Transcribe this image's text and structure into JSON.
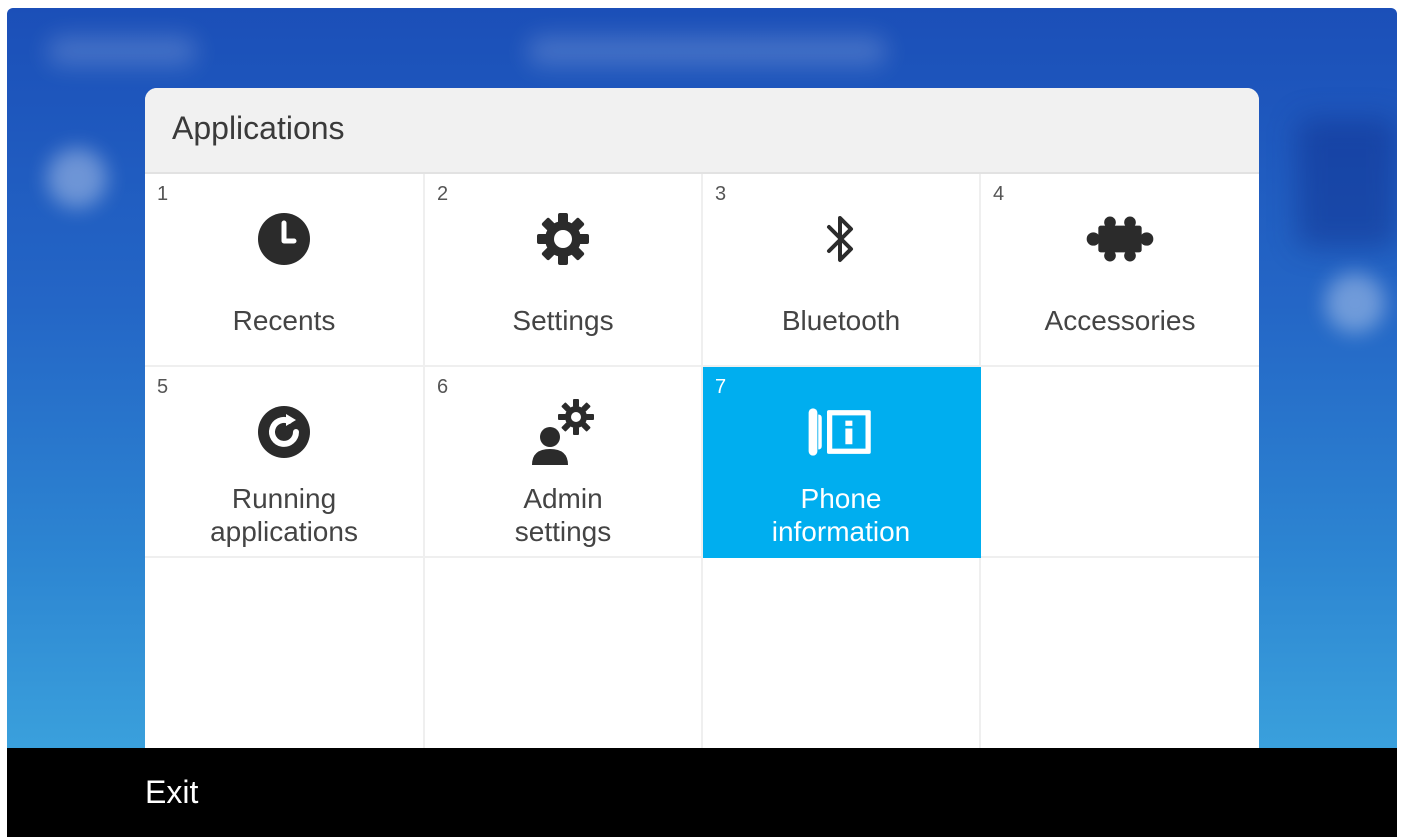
{
  "dialog": {
    "title": "Applications"
  },
  "apps": [
    {
      "number": "1",
      "label": "Recents",
      "icon": "clock-icon"
    },
    {
      "number": "2",
      "label": "Settings",
      "icon": "gear-icon"
    },
    {
      "number": "3",
      "label": "Bluetooth",
      "icon": "bluetooth-icon"
    },
    {
      "number": "4",
      "label": "Accessories",
      "icon": "puzzle-icon"
    },
    {
      "number": "5",
      "label_line1": "Running",
      "label_line2": "applications",
      "icon": "running-apps-icon"
    },
    {
      "number": "6",
      "label_line1": "Admin",
      "label_line2": "settings",
      "icon": "admin-settings-icon"
    },
    {
      "number": "7",
      "label_line1": "Phone",
      "label_line2": "information",
      "icon": "phone-info-icon",
      "selected": true
    }
  ],
  "softkeys": {
    "exit_label": "Exit"
  },
  "colors": {
    "selected_tile": "#00aeef",
    "icon_dark": "#2b2b2b",
    "softkey_bar": "#000000"
  }
}
